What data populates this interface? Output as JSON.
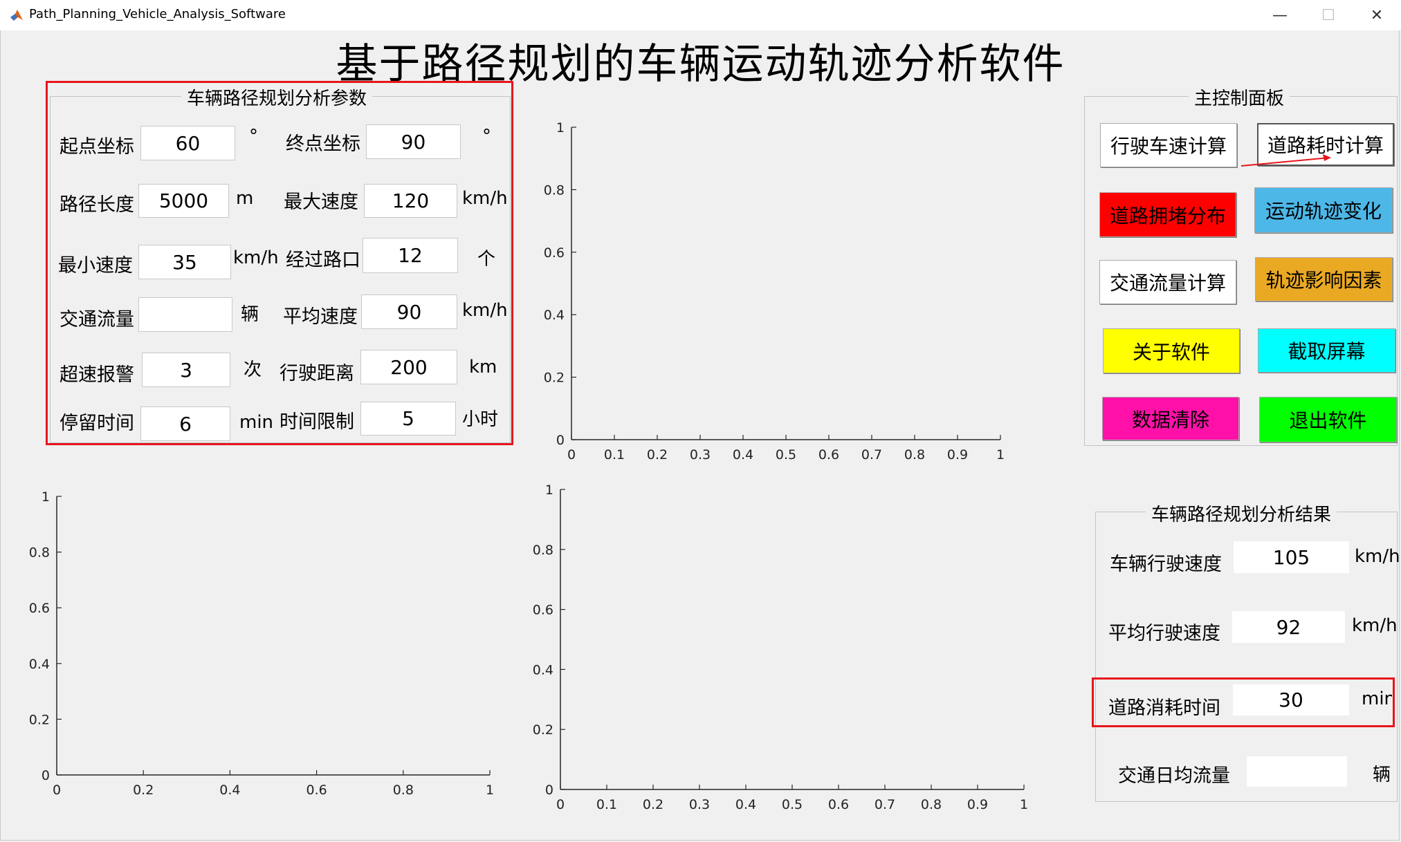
{
  "window": {
    "title": "Path_Planning_Vehicle_Analysis_Software",
    "min_glyph": "—",
    "max_glyph": "☐",
    "close_glyph": "✕"
  },
  "main_title": "基于路径规划的车辆运动轨迹分析软件",
  "params_panel": {
    "title": "车辆路径规划分析参数",
    "start_label": "起点坐标",
    "start_value": "60",
    "start_unit": "°",
    "end_label": "终点坐标",
    "end_value": "90",
    "end_unit": "°",
    "path_length_label": "路径长度",
    "path_length_value": "5000",
    "path_length_unit": "m",
    "max_speed_label": "最大速度",
    "max_speed_value": "120",
    "max_speed_unit": "km/h",
    "min_speed_label": "最小速度",
    "min_speed_value": "35",
    "min_speed_unit": "km/h",
    "crossings_label": "经过路口",
    "crossings_value": "12",
    "crossings_unit": "个",
    "traffic_label": "交通流量",
    "traffic_value": "",
    "traffic_unit": "辆",
    "avg_speed_label": "平均速度",
    "avg_speed_value": "90",
    "avg_speed_unit": "km/h",
    "speeding_label": "超速报警",
    "speeding_value": "3",
    "speeding_unit": "次",
    "distance_label": "行驶距离",
    "distance_value": "200",
    "distance_unit": "km",
    "stay_label": "停留时间",
    "stay_value": "6",
    "stay_unit": "min",
    "limit_label": "时间限制",
    "limit_value": "5",
    "limit_unit": "小时"
  },
  "control_panel": {
    "title": "主控制面板",
    "buttons": [
      {
        "label": "行驶车速计算",
        "bg": "#ffffff"
      },
      {
        "label": "道路耗时计算",
        "bg": "#ffffff"
      },
      {
        "label": "道路拥堵分布",
        "bg": "#ff0000"
      },
      {
        "label": "运动轨迹变化",
        "bg": "#4db8e8"
      },
      {
        "label": "交通流量计算",
        "bg": "#ffffff"
      },
      {
        "label": "轨迹影响因素",
        "bg": "#eaa923"
      },
      {
        "label": "关于软件",
        "bg": "#ffff00"
      },
      {
        "label": "截取屏幕",
        "bg": "#00ffff"
      },
      {
        "label": "数据清除",
        "bg": "#ff10a8"
      },
      {
        "label": "退出软件",
        "bg": "#00ff00"
      }
    ]
  },
  "results_panel": {
    "title": "车辆路径规划分析结果",
    "speed_label": "车辆行驶速度",
    "speed_value": "105",
    "speed_unit": "km/h",
    "avg_label": "平均行驶速度",
    "avg_value": "92",
    "avg_unit": "km/h",
    "time_label": "道路消耗时间",
    "time_value": "30",
    "time_unit": "min",
    "flow_label": "交通日均流量",
    "flow_value": "",
    "flow_unit": "辆"
  },
  "colors": {
    "highlight": "#e8141c",
    "axis": "#262626"
  },
  "chart_data": [
    {
      "type": "line",
      "series": [],
      "xlim": [
        0,
        1
      ],
      "ylim": [
        0,
        1
      ],
      "xticks": [
        "0",
        "0.1",
        "0.2",
        "0.3",
        "0.4",
        "0.5",
        "0.6",
        "0.7",
        "0.8",
        "0.9",
        "1"
      ],
      "yticks": [
        "0",
        "0.2",
        "0.4",
        "0.6",
        "0.8",
        "1"
      ],
      "grid": false
    },
    {
      "type": "line",
      "series": [],
      "xlim": [
        0,
        1
      ],
      "ylim": [
        0,
        1
      ],
      "xticks": [
        "0",
        "0.2",
        "0.4",
        "0.6",
        "0.8",
        "1"
      ],
      "yticks": [
        "0",
        "0.2",
        "0.4",
        "0.6",
        "0.8",
        "1"
      ],
      "grid": false
    },
    {
      "type": "line",
      "series": [],
      "xlim": [
        0,
        1
      ],
      "ylim": [
        0,
        1
      ],
      "xticks": [
        "0",
        "0.1",
        "0.2",
        "0.3",
        "0.4",
        "0.5",
        "0.6",
        "0.7",
        "0.8",
        "0.9",
        "1"
      ],
      "yticks": [
        "0",
        "0.2",
        "0.4",
        "0.6",
        "0.8",
        "1"
      ],
      "grid": false
    }
  ]
}
